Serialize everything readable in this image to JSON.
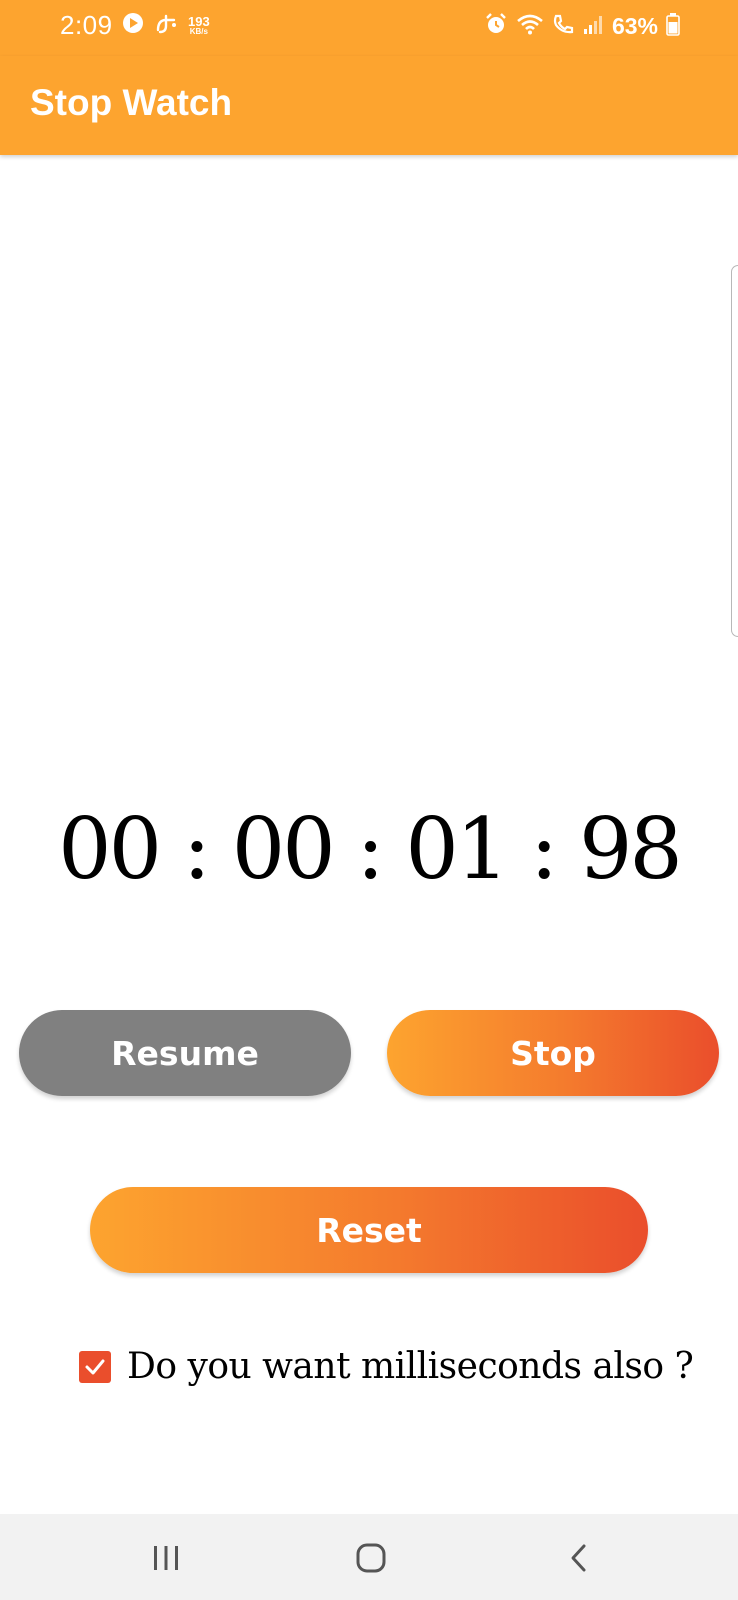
{
  "status_bar": {
    "time": "2:09",
    "net_speed_value": "193",
    "net_speed_unit": "KB/s",
    "battery": "63%",
    "icons": [
      "play-circle-icon",
      "link-icon",
      "alarm-icon",
      "wifi-icon",
      "call-icon",
      "signal-icon",
      "battery-icon"
    ]
  },
  "app_bar": {
    "title": "Stop Watch"
  },
  "timer": {
    "display": "00 : 00 : 01 : 98"
  },
  "buttons": {
    "resume_label": "Resume",
    "stop_label": "Stop",
    "reset_label": "Reset"
  },
  "milliseconds_option": {
    "label": "Do you want milliseconds also ?",
    "checked": true
  },
  "nav_bar": {
    "icons": [
      "recents-icon",
      "home-icon",
      "back-icon"
    ]
  },
  "colors": {
    "accent": "#fda42f",
    "gradient_end": "#ea4e2c",
    "resume_gray": "#808080"
  }
}
